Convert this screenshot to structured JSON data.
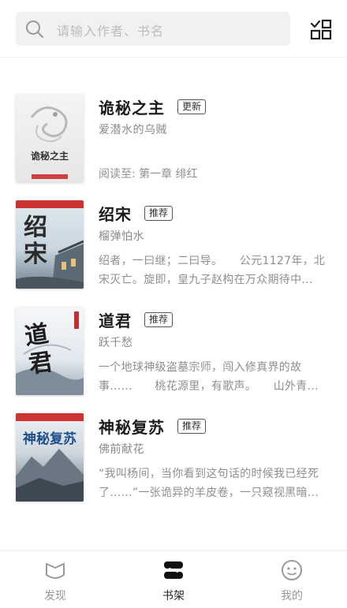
{
  "search": {
    "placeholder": "请输入作者、书名"
  },
  "books": [
    {
      "title": "诡秘之主",
      "badge": "更新",
      "author": "爱潜水的乌贼",
      "progress": "阅读至: 第一章 绯红",
      "cover_title": "诡秘之主"
    },
    {
      "title": "绍宋",
      "badge": "推荐",
      "author": "榴弹怕水",
      "description": "绍者，一曰继；二曰导。　　公元1127年，北宋灭亡。旋即，皇九子赵构在万众期待中...",
      "cover_title": "绍宋"
    },
    {
      "title": "道君",
      "badge": "推荐",
      "author": "跃千愁",
      "description": "一个地球神级盗墓宗师，闯入修真界的故事......　　桃花源里，有歌声。　　山外青...",
      "cover_title": "道君"
    },
    {
      "title": "神秘复苏",
      "badge": "推荐",
      "author": "佛前献花",
      "description": "“我叫杨间，当你看到这句话的时候我已经死了......”一张诡异的羊皮卷，一只窥视黑暗...",
      "cover_title": "神秘复苏"
    }
  ],
  "tabs": [
    {
      "label": "发现",
      "icon": "discover-icon",
      "active": false
    },
    {
      "label": "书架",
      "icon": "bookshelf-icon",
      "active": true
    },
    {
      "label": "我的",
      "icon": "smiley-icon",
      "active": false
    }
  ],
  "colors": {
    "accent": "#1c1c1c",
    "inactive": "#999999",
    "search_bg": "#f1f1f1"
  }
}
